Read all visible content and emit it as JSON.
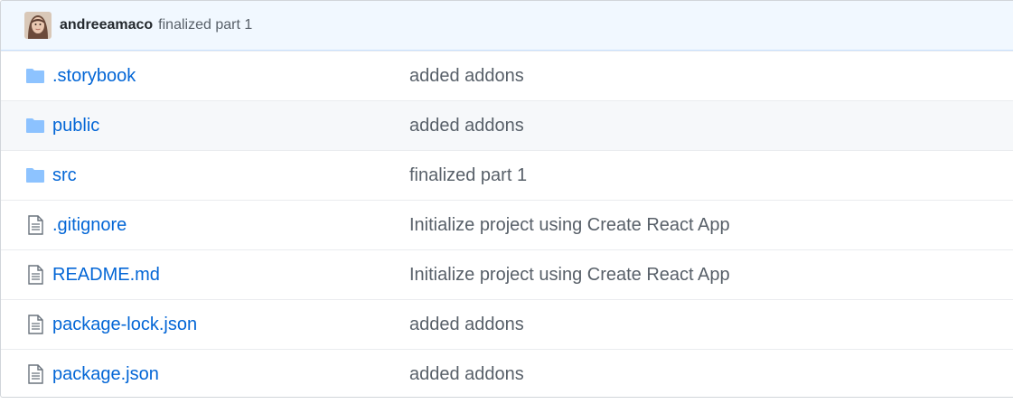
{
  "commit": {
    "author": "andreeamaco",
    "message": "finalized part 1"
  },
  "files": [
    {
      "name": ".storybook",
      "type": "folder",
      "commit": "added addons"
    },
    {
      "name": "public",
      "type": "folder",
      "commit": "added addons"
    },
    {
      "name": "src",
      "type": "folder",
      "commit": "finalized part 1"
    },
    {
      "name": ".gitignore",
      "type": "file",
      "commit": "Initialize project using Create React App"
    },
    {
      "name": "README.md",
      "type": "file",
      "commit": "Initialize project using Create React App"
    },
    {
      "name": "package-lock.json",
      "type": "file",
      "commit": "added addons"
    },
    {
      "name": "package.json",
      "type": "file",
      "commit": "added addons"
    }
  ],
  "colors": {
    "link": "#0366d6",
    "folder_icon": "#79b8ff",
    "file_icon": "#6a737d",
    "commit_bar_bg": "#f1f8ff"
  }
}
